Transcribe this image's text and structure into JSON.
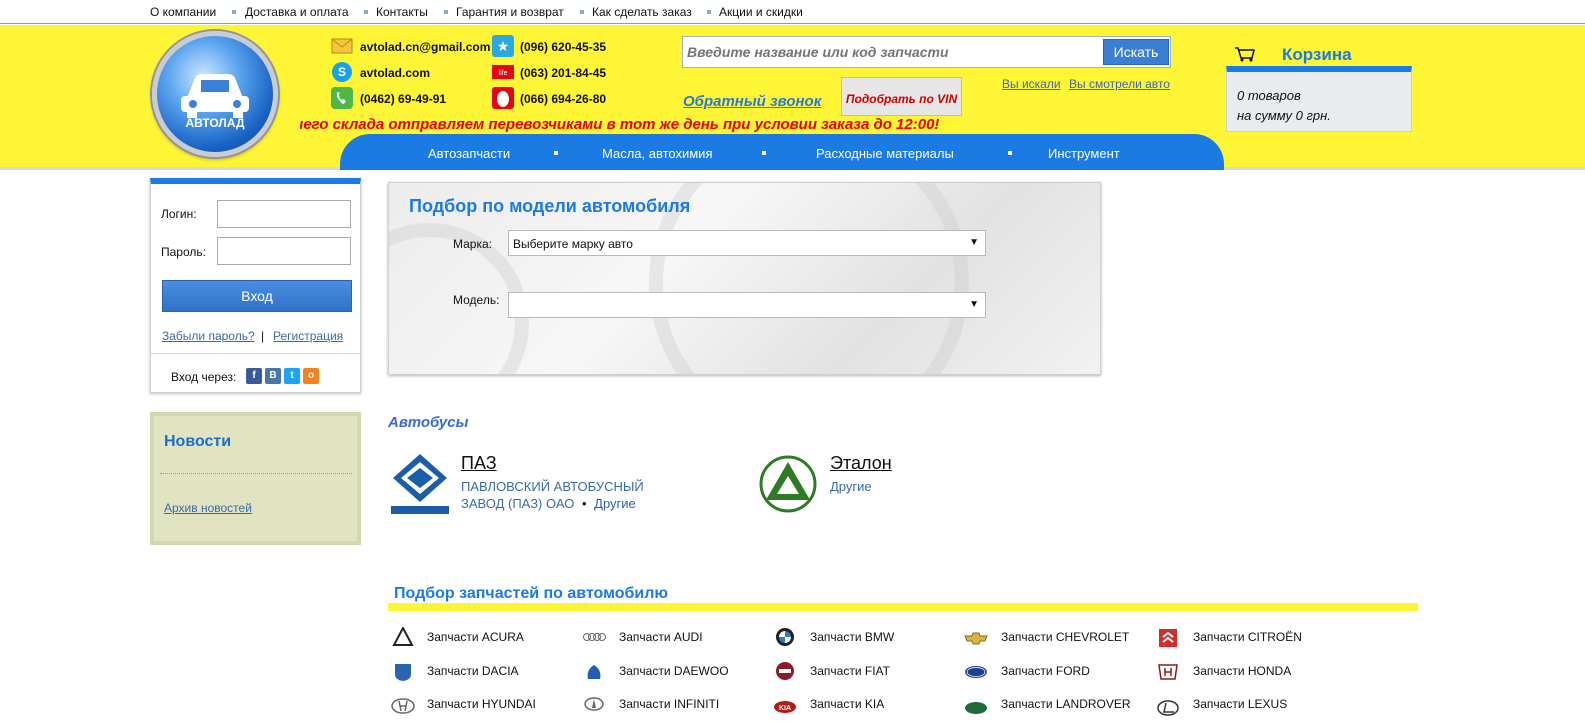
{
  "topnav": {
    "items": [
      "О компании",
      "Доставка и оплата",
      "Контакты",
      "Гарантия и возврат",
      "Как сделать заказ",
      "Акции и скидки"
    ]
  },
  "logo": {
    "text": "АВТОЛАД"
  },
  "contacts": {
    "email": "avtolad.cn@gmail.com",
    "skype": "avtolad.com",
    "phone_city": "(0462) 69-49-91",
    "phone_kyivstar": "(096) 620-45-35",
    "phone_mts": "(063) 201-84-45",
    "phone_life": "(066) 694-26-80"
  },
  "search": {
    "placeholder": "Введите название или код запчасти",
    "button": "Искать"
  },
  "header": {
    "callback": "Обратный звонок",
    "vin_button": "Подобрать по VIN",
    "searched_link": "Вы искали",
    "viewed_link": "Вы смотрели авто",
    "ticker": "шего склада отправляем перевозчиками в тот же день при условии заказа до 12:00!"
  },
  "cart": {
    "title": "Корзина",
    "items": "0 товаров",
    "sum": "на сумму 0 грн."
  },
  "categories": [
    "Автозапчасти",
    "Масла, автохимия",
    "Расходные материалы",
    "Инструмент"
  ],
  "login": {
    "login_label": "Логин:",
    "password_label": "Пароль:",
    "button": "Вход",
    "forgot": "Забыли пароль?",
    "separator": "|",
    "register": "Регистрация",
    "via": "Вход через:"
  },
  "news": {
    "title": "Новости",
    "archive": "Архив новостей"
  },
  "selector": {
    "title": "Подбор по модели автомобиля",
    "brand_label": "Марка:",
    "brand_value": "Выберите марку авто",
    "model_label": "Модель:",
    "model_value": ""
  },
  "buses": {
    "heading": "Автобусы",
    "items": [
      {
        "name": "ПАЗ",
        "desc": "ПАВЛОВСКИЙ АВТОБУСНЫЙ ЗАВОД (ПАЗ) ОАО",
        "bullet": "•",
        "other": "Другие"
      },
      {
        "name": "Эталон",
        "other": "Другие"
      }
    ]
  },
  "parts": {
    "heading": "Подбор запчастей по автомобилю",
    "items": [
      "Запчасти ACURA",
      "Запчасти AUDI",
      "Запчасти BMW",
      "Запчасти CHEVROLET",
      "Запчасти CITROËN",
      "Запчасти DACIA",
      "Запчасти DAEWOO",
      "Запчасти FIAT",
      "Запчасти FORD",
      "Запчасти HONDA",
      "Запчасти HYUNDAI",
      "Запчасти INFINITI",
      "Запчасти KIA",
      "Запчасти LANDROVER",
      "Запчасти LEXUS"
    ]
  },
  "colors": {
    "accent_blue": "#1b7be3",
    "header_yellow": "#fff537",
    "ticker_red": "#e60000"
  }
}
